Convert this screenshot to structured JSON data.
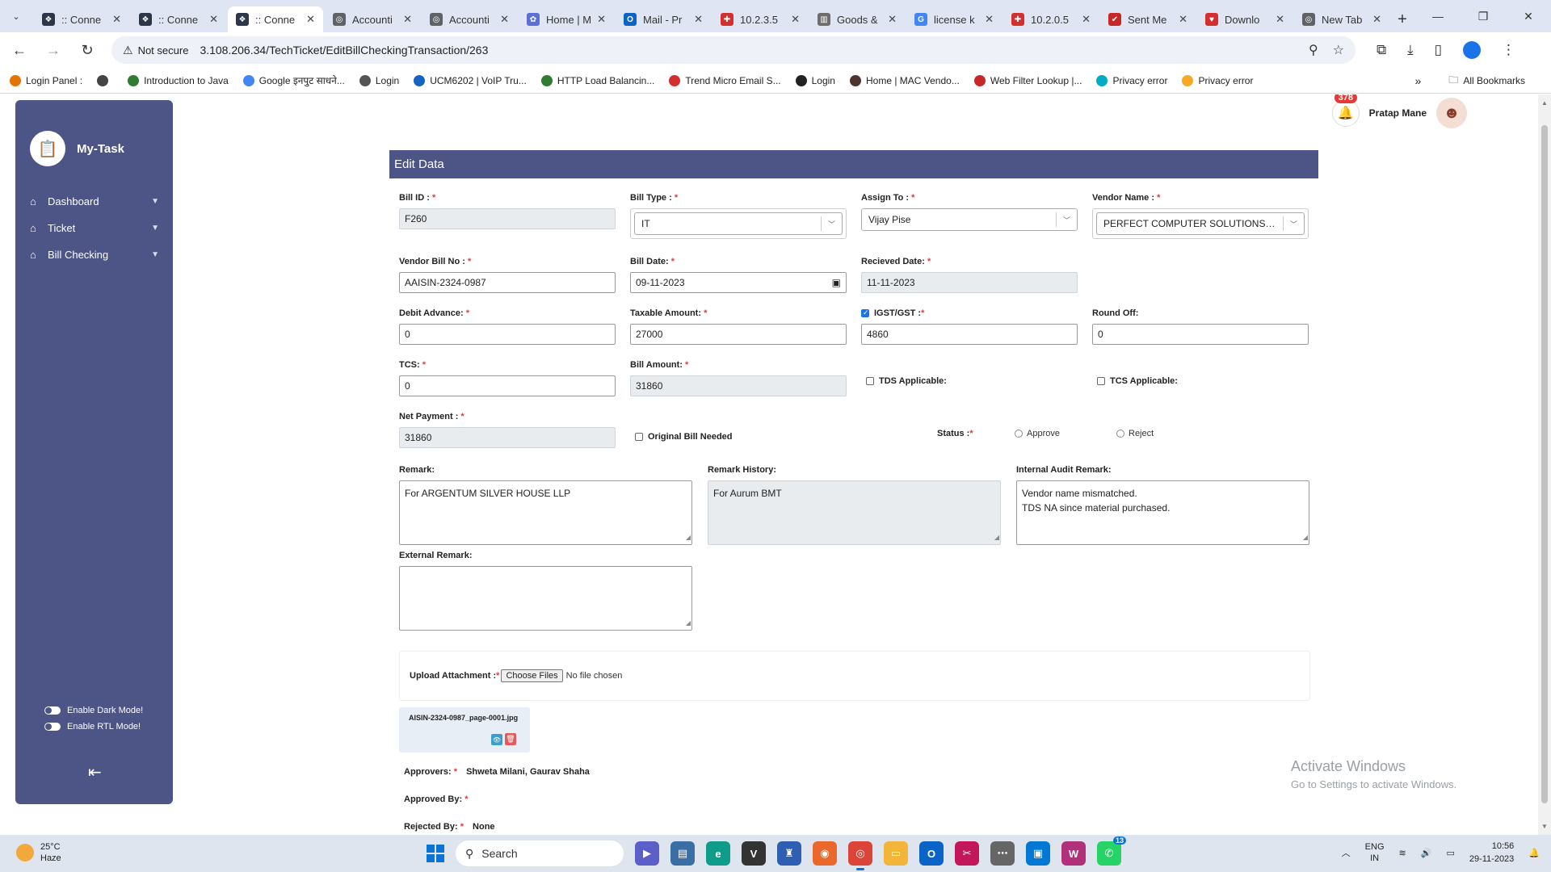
{
  "browser": {
    "tabs": [
      {
        "title": ":: Conne",
        "color": "#2d3748",
        "glyph": "❖",
        "active": false
      },
      {
        "title": ":: Conne",
        "color": "#2d3748",
        "glyph": "❖",
        "active": false
      },
      {
        "title": ":: Conne",
        "color": "#2d3748",
        "glyph": "❖",
        "active": true
      },
      {
        "title": "Accounti",
        "color": "#5f6368",
        "glyph": "◎",
        "active": false
      },
      {
        "title": "Accounti",
        "color": "#5f6368",
        "glyph": "◎",
        "active": false
      },
      {
        "title": "Home | M",
        "color": "#5b6fd6",
        "glyph": "✿",
        "active": false
      },
      {
        "title": "Mail - Pr",
        "color": "#0a64c8",
        "glyph": "O",
        "active": false
      },
      {
        "title": "10.2.3.5",
        "color": "#d32f2f",
        "glyph": "✚",
        "active": false
      },
      {
        "title": "Goods &",
        "color": "#6d6d6d",
        "glyph": "▥",
        "active": false
      },
      {
        "title": "license k",
        "color": "#4285f4",
        "glyph": "G",
        "active": false
      },
      {
        "title": "10.2.0.5",
        "color": "#d32f2f",
        "glyph": "✚",
        "active": false
      },
      {
        "title": "Sent Me",
        "color": "#c62828",
        "glyph": "✔",
        "active": false
      },
      {
        "title": "Downlo",
        "color": "#d32f2f",
        "glyph": "♥",
        "active": false
      },
      {
        "title": "New Tab",
        "color": "#5f6368",
        "glyph": "◎",
        "active": false
      }
    ],
    "security_label": "Not secure",
    "url": "3.108.206.34/TechTicket/EditBillCheckingTransaction/263",
    "bookmarks": [
      {
        "label": "Login Panel :",
        "color": "#e37400"
      },
      {
        "label": "",
        "color": "#444"
      },
      {
        "label": "Introduction to Java",
        "color": "#2e7d32"
      },
      {
        "label": "Google इनपुट साधने...",
        "color": "#4285f4"
      },
      {
        "label": "Login",
        "color": "#555"
      },
      {
        "label": "UCM6202 | VoIP Tru...",
        "color": "#1565c0"
      },
      {
        "label": "HTTP Load Balancin...",
        "color": "#2e7d32"
      },
      {
        "label": "Trend Micro Email S...",
        "color": "#d32f2f"
      },
      {
        "label": "Login",
        "color": "#222"
      },
      {
        "label": "Home | MAC Vendo...",
        "color": "#4e342e"
      },
      {
        "label": "Web Filter Lookup |...",
        "color": "#c62828"
      },
      {
        "label": "Privacy error",
        "color": "#00acc1"
      },
      {
        "label": "Privacy error",
        "color": "#f9a825"
      }
    ],
    "all_bookmarks": "All Bookmarks"
  },
  "sidebar": {
    "brand": "My-Task",
    "items": [
      {
        "label": "Dashboard"
      },
      {
        "label": "Ticket"
      },
      {
        "label": "Bill Checking"
      }
    ],
    "dark_mode": "Enable Dark Mode!",
    "rtl_mode": "Enable RTL Mode!"
  },
  "user": {
    "notifications": "378",
    "name": "Pratap Mane"
  },
  "form": {
    "title": "Edit Data",
    "bill_id": {
      "label": "Bill ID :",
      "value": "F260"
    },
    "bill_type": {
      "label": "Bill Type :",
      "value": "IT"
    },
    "assign_to": {
      "label": "Assign To :",
      "value": "Vijay Pise"
    },
    "vendor_name": {
      "label": "Vendor Name :",
      "value": "PERFECT COMPUTER SOLUTIONS P..."
    },
    "vendor_bill_no": {
      "label": "Vendor Bill No :",
      "value": "AAISIN-2324-0987"
    },
    "bill_date": {
      "label": "Bill Date:",
      "value": "09-11-2023"
    },
    "received_date": {
      "label": "Recieved Date:",
      "value": "11-11-2023"
    },
    "debit_advance": {
      "label": "Debit Advance:",
      "value": "0"
    },
    "taxable_amount": {
      "label": "Taxable Amount:",
      "value": "27000"
    },
    "igst_gst": {
      "label": "IGST/GST :",
      "value": "4860",
      "checked": true
    },
    "round_off": {
      "label": "Round Off:",
      "value": "0"
    },
    "tcs": {
      "label": "TCS:",
      "value": "0"
    },
    "bill_amount": {
      "label": "Bill Amount:",
      "value": "31860"
    },
    "tds_applicable": {
      "label": "TDS Applicable:"
    },
    "tcs_applicable": {
      "label": "TCS Applicable:"
    },
    "net_payment": {
      "label": "Net Payment :",
      "value": "31860"
    },
    "original_bill_needed": {
      "label": "Original Bill Needed"
    },
    "status": {
      "label": "Status :",
      "options": [
        "Approve",
        "Reject"
      ]
    },
    "remark": {
      "label": "Remark:",
      "value": "For ARGENTUM SILVER HOUSE LLP"
    },
    "remark_history": {
      "label": "Remark History:",
      "value": "For Aurum BMT"
    },
    "internal_audit_remark": {
      "label": "Internal Audit Remark:",
      "value": "Vendor name mismatched.\nTDS NA since material purchased."
    },
    "external_remark": {
      "label": "External Remark:",
      "value": ""
    },
    "upload": {
      "label": "Upload Attachment :",
      "button": "Choose Files",
      "status": "No file chosen"
    },
    "attachment": {
      "filename": "AISIN-2324-0987_page-0001.jpg"
    },
    "approvers": {
      "label": "Approvers:",
      "value": "Shweta Milani, Gaurav Shaha"
    },
    "approved_by": {
      "label": "Approved By:",
      "value": ""
    },
    "rejected_by": {
      "label": "Rejected By:",
      "value": "None"
    }
  },
  "watermark": {
    "line1": "Activate Windows",
    "line2": "Go to Settings to activate Windows."
  },
  "taskbar": {
    "temp": "25°C",
    "weather": "Haze",
    "search": "Search",
    "lang1": "ENG",
    "lang2": "IN",
    "time": "10:56",
    "date": "29-11-2023",
    "chat_count": "13"
  }
}
